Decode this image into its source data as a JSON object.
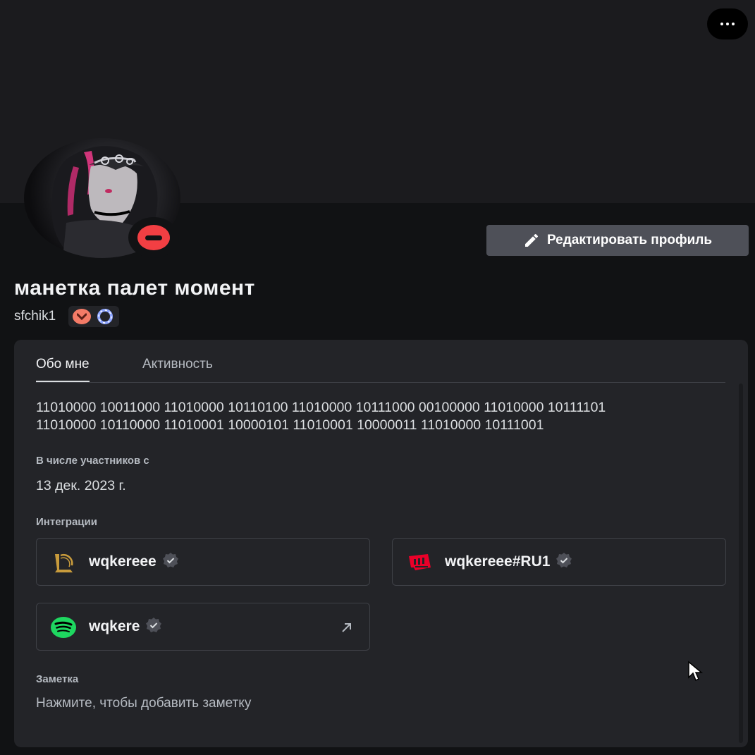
{
  "header": {
    "more_button_label": "more-options"
  },
  "profile": {
    "display_name": "манетка палет момент",
    "username": "sfchik1",
    "status": "dnd",
    "edit_button_label": "Редактировать профиль"
  },
  "tabs": [
    {
      "label": "Обо мне",
      "active": true
    },
    {
      "label": "Активность",
      "active": false
    }
  ],
  "about": {
    "bio_line1": "11010000 10011000 11010000 10110100 11010000 10111000 00100000 11010000 10111101",
    "bio_line2": "11010000 10110000 11010001 10000101 11010001 10000011 11010000 10111001",
    "member_since_label": "В числе участников с",
    "member_since_value": "13 дек. 2023 г.",
    "integrations_label": "Интеграции",
    "integrations": [
      {
        "service_icon": "league-of-legends-icon",
        "name": "wqkereee"
      },
      {
        "service_icon": "riot-games-icon",
        "name": "wqkereee#RU1"
      },
      {
        "service_icon": "spotify-icon",
        "name": "wqkere"
      }
    ],
    "note_label": "Заметка",
    "note_placeholder": "Нажмите, чтобы добавить заметку"
  },
  "colors": {
    "background": "#111214",
    "card": "#232428",
    "button": "#4e5058",
    "dnd": "#f23f43",
    "spotify": "#1ed760",
    "riot": "#eb0029",
    "lol_gold": "#c89b3c"
  }
}
